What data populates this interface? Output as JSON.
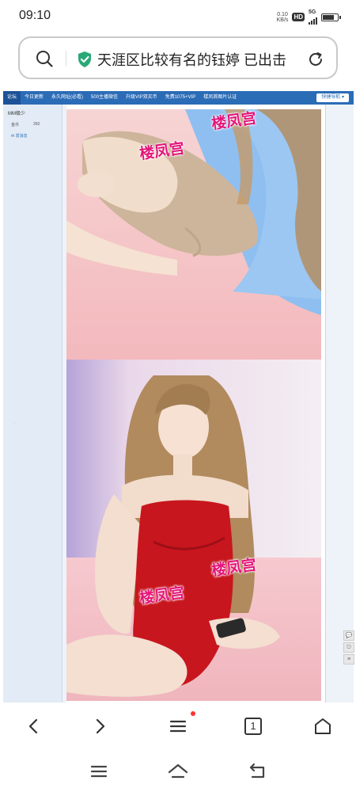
{
  "status": {
    "time": "09:10",
    "net_speed_value": "0.10",
    "net_speed_unit": "KB/s",
    "hd": "HD",
    "network": "5G",
    "battery_level": 0.85
  },
  "url_bar": {
    "text": "天涯区比较有名的钰婷 已出击",
    "icons": [
      "search-icon",
      "shield-check-icon",
      "reload-icon"
    ]
  },
  "site": {
    "nav_items": [
      "论坛",
      "今日更新",
      "永久网址(必看)",
      "500主播微信",
      "升级VIP双买币",
      "免费1075+VIP",
      "楼凤首图片认证"
    ],
    "quick_nav": "快捷导航 ▾",
    "sidebar": {
      "title": "MM极少",
      "coin_label": "金币",
      "coin_value": "260",
      "link": "发消息"
    },
    "watermark_text": "楼凤宫"
  },
  "colors": {
    "nav_bg": "#2b6cb7",
    "watermark": "#e4147a",
    "dress": "#c8161e",
    "bed": "#f4c6c8"
  },
  "float_buttons": [
    "💬",
    "⎋",
    "≡"
  ],
  "browser_nav": {
    "tab_count": "1",
    "icons": [
      "back-icon",
      "forward-icon",
      "menu-icon",
      "tabs-icon",
      "home-icon"
    ]
  },
  "system_nav": {
    "icons": [
      "recent-apps-icon",
      "home-icon",
      "back-icon"
    ]
  }
}
